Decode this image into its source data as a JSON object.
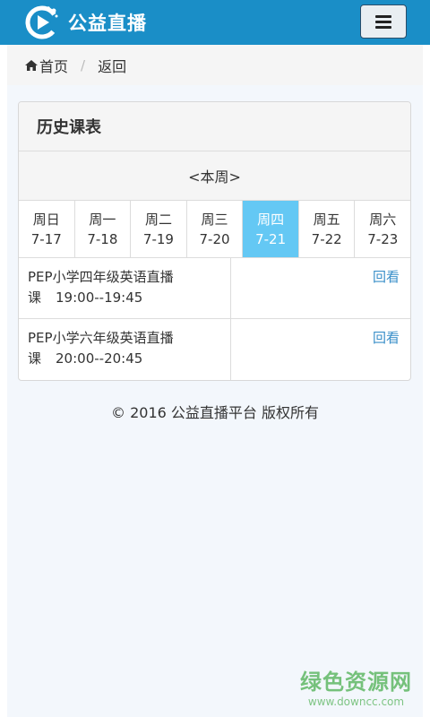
{
  "header": {
    "brand": "公益直播",
    "logo_icon": "play-logo-icon",
    "menu_icon": "hamburger-menu-icon",
    "bg_color": "#1a8ec7"
  },
  "breadcrumb": {
    "home_label": "首页",
    "separator": "/",
    "back_label": "返回"
  },
  "panel": {
    "heading": "历史课表",
    "week_nav": "<本周>",
    "days": [
      {
        "name": "周日",
        "date": "7-17",
        "active": false
      },
      {
        "name": "周一",
        "date": "7-18",
        "active": false
      },
      {
        "name": "周二",
        "date": "7-19",
        "active": false
      },
      {
        "name": "周三",
        "date": "7-20",
        "active": false
      },
      {
        "name": "周四",
        "date": "7-21",
        "active": true
      },
      {
        "name": "周五",
        "date": "7-22",
        "active": false
      },
      {
        "name": "周六",
        "date": "7-23",
        "active": false
      }
    ],
    "active_color": "#64c8f4",
    "lessons": [
      {
        "title": "PEP小学四年级英语直播课",
        "line1": "PEP小学四年级英语直播",
        "line2_prefix": "课",
        "time": "19:00--19:45",
        "action": "回看"
      },
      {
        "title": "PEP小学六年级英语直播课",
        "line1": "PEP小学六年级英语直播",
        "line2_prefix": "课",
        "time": "20:00--20:45",
        "action": "回看"
      }
    ]
  },
  "footer": {
    "text": "© 2016 公益直播平台 版权所有"
  },
  "watermark": {
    "main": "绿色资源网",
    "url": "www.downcc.com"
  }
}
